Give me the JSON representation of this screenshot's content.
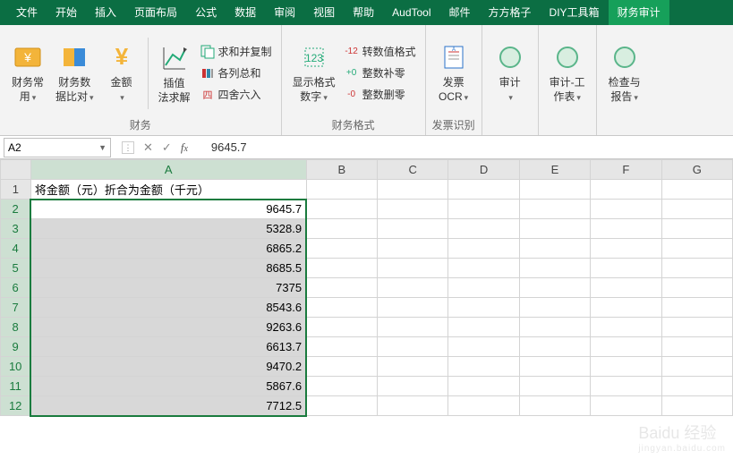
{
  "tabs": [
    "文件",
    "开始",
    "插入",
    "页面布局",
    "公式",
    "数据",
    "审阅",
    "视图",
    "帮助",
    "AudTool",
    "邮件",
    "方方格子",
    "DIY工具箱",
    "财务审计"
  ],
  "activeTab": 13,
  "ribbon": {
    "g1": {
      "label": "财务",
      "b1": "财务常\n用",
      "b2": "财务数\n据比对",
      "b3": "金额",
      "b4": "插值\n法求解",
      "s1": "求和并复制",
      "s2": "各列总和",
      "s3": "四舍六入"
    },
    "g2": {
      "label": "财务格式",
      "b1": "显示格式\n数字",
      "s1": "转数值格式",
      "s2": "整数补零",
      "s3": "整数删零"
    },
    "g3": {
      "label": "发票识别",
      "b1": "发票\nOCR"
    },
    "g4": {
      "b1": "审计"
    },
    "g5": {
      "b1": "审计-工\n作表"
    },
    "g6": {
      "b1": "检查与\n报告"
    }
  },
  "namebox": "A2",
  "formula": "9645.7",
  "cols": [
    "A",
    "B",
    "C",
    "D",
    "E",
    "F",
    "G"
  ],
  "rows": [
    1,
    2,
    3,
    4,
    5,
    6,
    7,
    8,
    9,
    10,
    11,
    12
  ],
  "header_cell": "将金额（元）折合为金额（千元）",
  "values": [
    "9645.7",
    "5328.9",
    "6865.2",
    "8685.5",
    "7375",
    "8543.6",
    "9263.6",
    "6613.7",
    "9470.2",
    "5867.6",
    "7712.5"
  ],
  "watermark": {
    "main": "Baidu 经验",
    "sub": "jingyan.baidu.com"
  }
}
